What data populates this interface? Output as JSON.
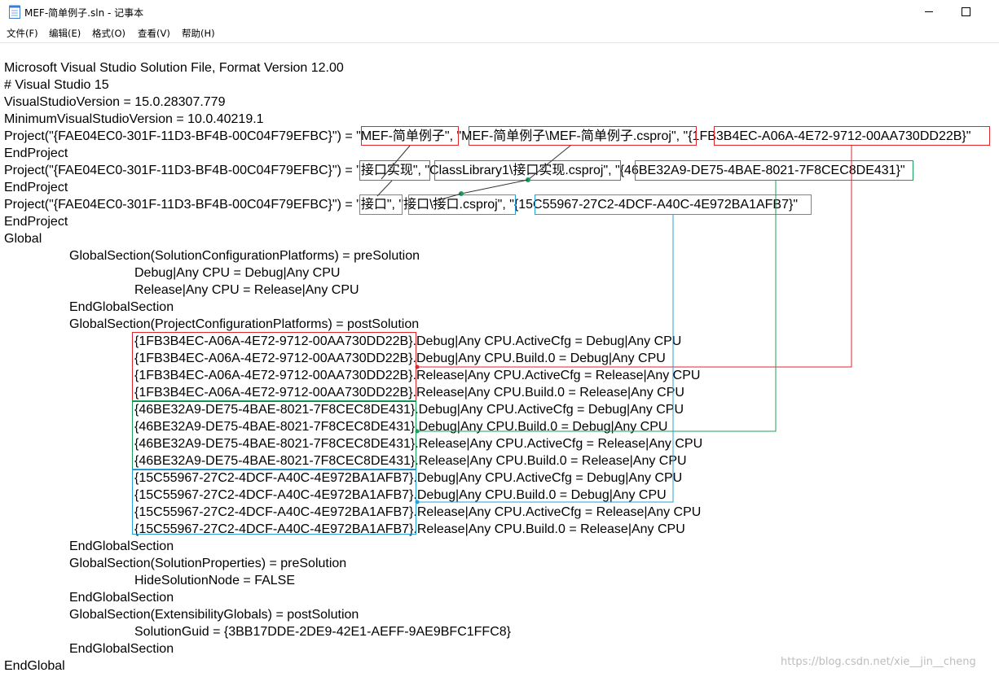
{
  "window": {
    "title": "MEF-简单例子.sln - 记事本",
    "icon": "notepad-icon",
    "buttons": [
      "minimize-icon",
      "maximize-icon"
    ]
  },
  "menu": [
    "文件(F)",
    "编辑(E)",
    "格式(O)",
    "查看(V)",
    "帮助(H)"
  ],
  "lines": [
    "Microsoft Visual Studio Solution File, Format Version 12.00",
    "# Visual Studio 15",
    "VisualStudioVersion = 15.0.28307.779",
    "MinimumVisualStudioVersion = 10.0.40219.1",
    "Project(\"{FAE04EC0-301F-11D3-BF4B-00C04F79EFBC}\") = \"MEF-简单例子\", \"MEF-简单例子\\MEF-简单例子.csproj\", \"{1FB3B4EC-A06A-4E72-9712-00AA730DD22B}\"",
    "EndProject",
    "Project(\"{FAE04EC0-301F-11D3-BF4B-00C04F79EFBC}\") = \"接口实现\", \"ClassLibrary1\\接口实现.csproj\", \"{46BE32A9-DE75-4BAE-8021-7F8CEC8DE431}\"",
    "EndProject",
    "Project(\"{FAE04EC0-301F-11D3-BF4B-00C04F79EFBC}\") = \"接口\", \"接口\\接口.csproj\", \"{15C55967-27C2-4DCF-A40C-4E972BA1AFB7}\"",
    "EndProject",
    "Global",
    "GlobalSection(SolutionConfigurationPlatforms) = preSolution",
    "Debug|Any CPU = Debug|Any CPU",
    "Release|Any CPU = Release|Any CPU",
    "EndGlobalSection",
    "GlobalSection(ProjectConfigurationPlatforms) = postSolution",
    "{1FB3B4EC-A06A-4E72-9712-00AA730DD22B}.Debug|Any CPU.ActiveCfg = Debug|Any CPU",
    "{1FB3B4EC-A06A-4E72-9712-00AA730DD22B}.Debug|Any CPU.Build.0 = Debug|Any CPU",
    "{1FB3B4EC-A06A-4E72-9712-00AA730DD22B}.Release|Any CPU.ActiveCfg = Release|Any CPU",
    "{1FB3B4EC-A06A-4E72-9712-00AA730DD22B}.Release|Any CPU.Build.0 = Release|Any CPU",
    "{46BE32A9-DE75-4BAE-8021-7F8CEC8DE431}.Debug|Any CPU.ActiveCfg = Debug|Any CPU",
    "{46BE32A9-DE75-4BAE-8021-7F8CEC8DE431}.Debug|Any CPU.Build.0 = Debug|Any CPU",
    "{46BE32A9-DE75-4BAE-8021-7F8CEC8DE431}.Release|Any CPU.ActiveCfg = Release|Any CPU",
    "{46BE32A9-DE75-4BAE-8021-7F8CEC8DE431}.Release|Any CPU.Build.0 = Release|Any CPU",
    "{15C55967-27C2-4DCF-A40C-4E972BA1AFB7}.Debug|Any CPU.ActiveCfg = Debug|Any CPU",
    "{15C55967-27C2-4DCF-A40C-4E972BA1AFB7}.Debug|Any CPU.Build.0 = Debug|Any CPU",
    "{15C55967-27C2-4DCF-A40C-4E972BA1AFB7}.Release|Any CPU.ActiveCfg = Release|Any CPU",
    "{15C55967-27C2-4DCF-A40C-4E972BA1AFB7}.Release|Any CPU.Build.0 = Release|Any CPU",
    "EndGlobalSection",
    "GlobalSection(SolutionProperties) = preSolution",
    "HideSolutionNode = FALSE",
    "EndGlobalSection",
    "GlobalSection(ExtensibilityGlobals) = postSolution",
    "SolutionGuid = {3BB17DDE-2DE9-42E1-AEFF-9AE9BFC1FFC8}",
    "EndGlobalSection",
    "EndGlobal"
  ],
  "annotation_colors": {
    "project1": "#e0262c",
    "project2": "#1aa05a",
    "project3": "#28a0d8"
  },
  "watermark": "https://blog.csdn.net/xie__jin__cheng"
}
